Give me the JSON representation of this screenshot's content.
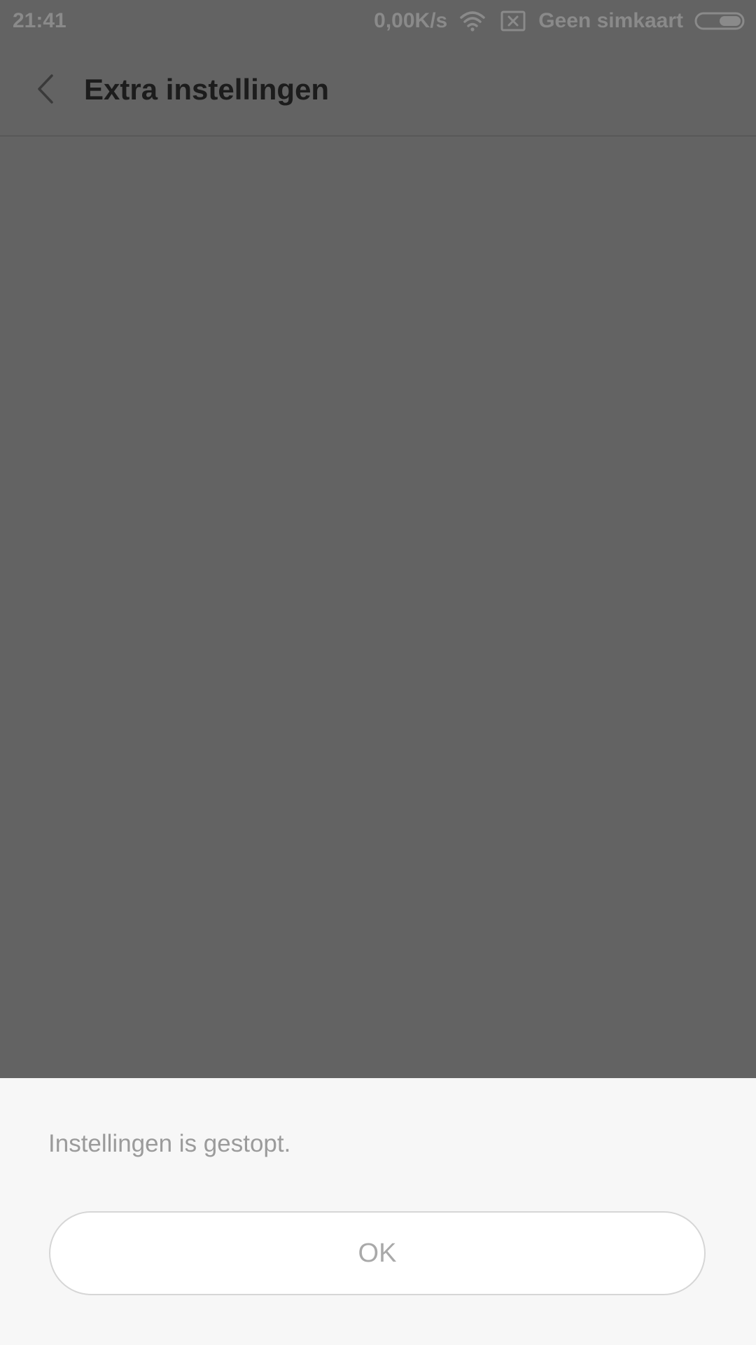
{
  "status_bar": {
    "time": "21:41",
    "speed": "0,00K/s",
    "carrier": "Geen simkaart",
    "icons": [
      "wifi-icon",
      "no-sim-icon",
      "battery-icon"
    ]
  },
  "app_bar": {
    "title": "Extra instellingen",
    "back_icon": "chevron-left-icon"
  },
  "dialog": {
    "message": "Instellingen is gestopt.",
    "ok_label": "OK"
  },
  "colors": {
    "scrim": "#636363",
    "dialog_bg": "#f7f7f7",
    "button_bg": "#ffffff",
    "muted_text": "#9b9b9b"
  }
}
